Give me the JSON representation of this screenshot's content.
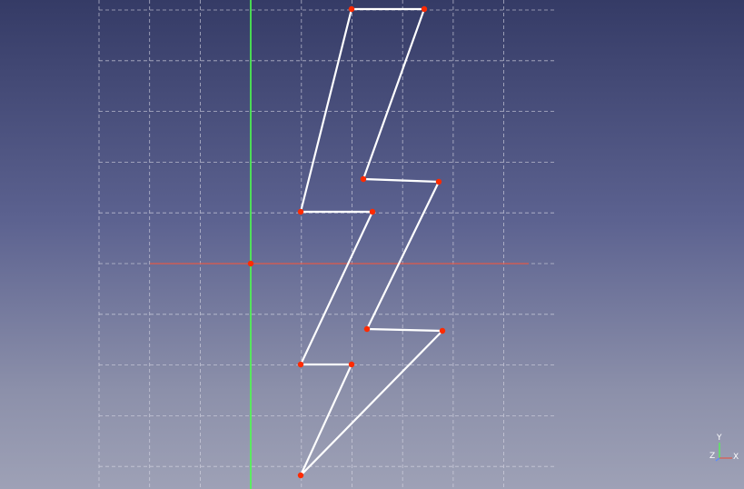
{
  "view": {
    "background_top": "#353b66",
    "background_bottom": "#9ea1b6",
    "grid_color": "#d8d8e4",
    "sketch_line_color": "#ffffff",
    "vertex_color": "#ff2a00",
    "x_axis_color": "#e05a4a",
    "y_axis_color": "#4cff4c"
  },
  "axis_indicator": {
    "y_label": "Y",
    "z_label": "Z",
    "x_label": "X"
  }
}
